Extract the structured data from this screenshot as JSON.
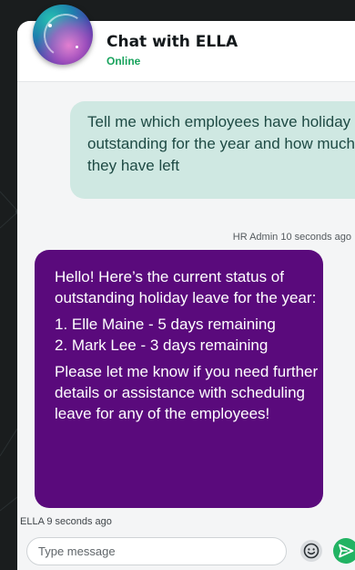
{
  "header": {
    "title": "Chat with ELLA",
    "status": "Online",
    "status_color": "#19a35d",
    "avatar_icon": "ella-orb-avatar"
  },
  "messages": [
    {
      "sender": "user",
      "text": "Tell me which employees have holiday outstanding for the year and how much they have left",
      "meta": "HR Admin 10 seconds ago",
      "bubble_color": "#cfe8e2"
    },
    {
      "sender": "bot",
      "paragraphs": [
        "Hello! Here’s the current status of outstanding holiday leave for the year:",
        "1. Elle Maine - 5 days remaining\n2. Mark Lee - 3 days remaining",
        "Please let me know if you need further details or assistance with scheduling leave for any of the employees!"
      ],
      "meta": "ELLA 9 seconds ago",
      "bubble_color": "#5a0a7c"
    }
  ],
  "composer": {
    "placeholder": "Type message",
    "emoji_icon": "smiley-icon",
    "send_icon": "send-icon",
    "send_color": "#22b363"
  }
}
